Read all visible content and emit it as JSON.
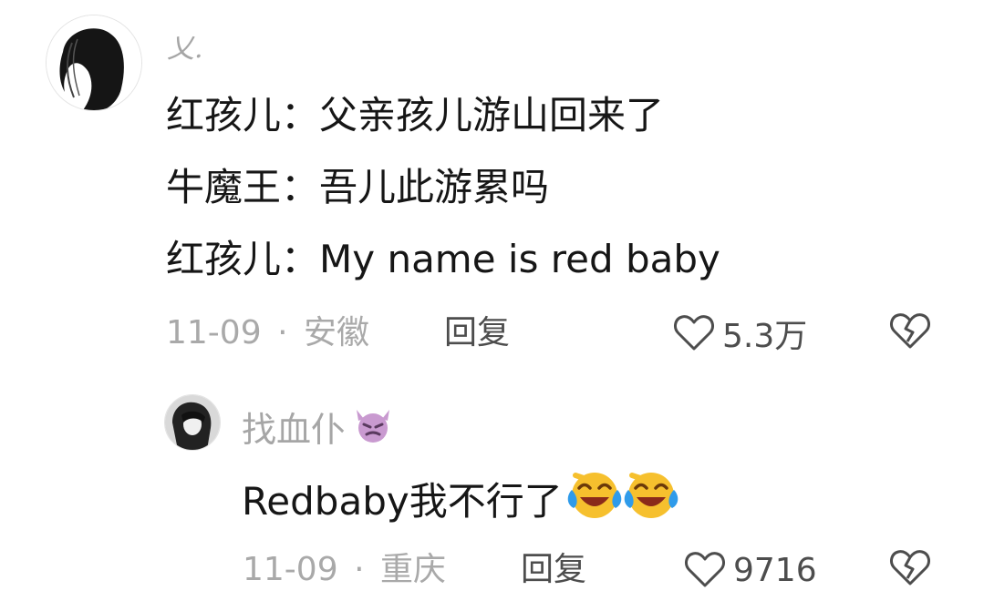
{
  "comment": {
    "username": "乂.",
    "lines": [
      "红孩儿：父亲孩儿游山回来了",
      "牛魔王：吾儿此游累吗",
      "红孩儿：My name is red baby"
    ],
    "date": "11-09",
    "separator": "·",
    "location": "安徽",
    "reply_label": "回复",
    "like_count": "5.3万",
    "icons": {
      "like": "heart-outline-icon",
      "dislike": "broken-heart-icon"
    }
  },
  "reply": {
    "username": "找血仆",
    "username_emoji": "devil-emoji-icon",
    "text": "Redbaby我不行了",
    "text_emojis": [
      "laughing-crying-emoji-icon",
      "laughing-crying-emoji-icon"
    ],
    "date": "11-09",
    "separator": "·",
    "location": "重庆",
    "reply_label": "回复",
    "like_count": "9716",
    "icons": {
      "like": "heart-outline-icon",
      "dislike": "broken-heart-icon"
    }
  },
  "colors": {
    "username": "#a6a6a6",
    "text": "#161616",
    "meta": "#a9a9a9",
    "action": "#4d4d4d",
    "emoji_face": "#f6c02e",
    "emoji_tears": "#2f9bea"
  }
}
